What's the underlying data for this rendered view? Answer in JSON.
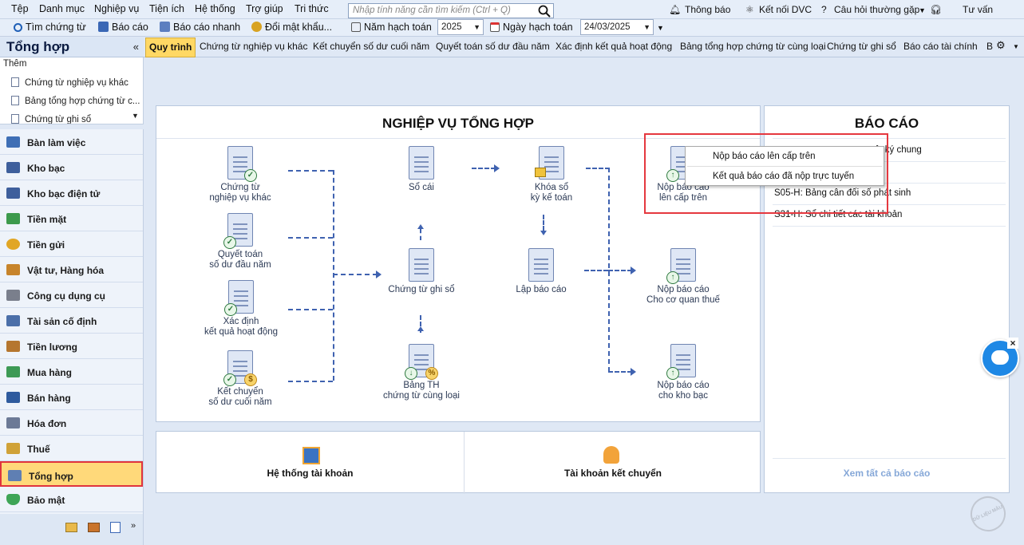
{
  "menu": {
    "items": [
      "Tệp",
      "Danh mục",
      "Nghiệp vụ",
      "Tiện ích",
      "Hệ thống",
      "Trợ giúp",
      "Tri thức"
    ],
    "search_placeholder": "Nhập tính năng cần tìm kiếm (Ctrl + Q)",
    "notify": "Thông báo",
    "connect": "Kết nối DVC",
    "faq": "Câu hỏi thường gặp",
    "support": "Tư vấn"
  },
  "toolbar": {
    "find": "Tìm chứng từ",
    "report": "Báo cáo",
    "quick_report": "Báo cáo nhanh",
    "change_pw": "Đổi mật khẩu...",
    "year_label": "Năm hạch toán",
    "year": "2025",
    "date_label": "Ngày hạch toán",
    "date": "24/03/2025"
  },
  "left": {
    "title": "Tổng hợp",
    "collapse": "«",
    "more": "Thêm",
    "sub_items": [
      "Chứng từ nghiệp vụ khác",
      "Bảng tổng hợp chứng từ c...",
      "Chứng từ ghi sổ"
    ],
    "nav": [
      "Bàn làm việc",
      "Kho bạc",
      "Kho bạc điện tử",
      "Tiền mặt",
      "Tiền gửi",
      "Vật tư, Hàng hóa",
      "Công cụ dụng cụ",
      "Tài sản cố định",
      "Tiền lương",
      "Mua hàng",
      "Bán hàng",
      "Hóa đơn",
      "Thuế",
      "Tổng hợp",
      "Bảo mật"
    ]
  },
  "tabs": [
    "Quy trình",
    "Chứng từ nghiệp vụ khác",
    "Kết chuyển số dư cuối năm",
    "Quyết toán số dư đầu năm",
    "Xác định kết quả hoạt động",
    "Bảng tổng hợp chứng từ cùng loại",
    "Chứng từ ghi sổ",
    "Báo cáo tài chính",
    "B"
  ],
  "flow": {
    "title": "NGHIỆP VỤ TỔNG HỢP",
    "n1a": "Chứng từ",
    "n1b": "nghiệp vụ khác",
    "n2a": "Quyết toán",
    "n2b": "số dư đầu năm",
    "n3a": "Xác định",
    "n3b": "kết quả hoạt động",
    "n4a": "Kết chuyển",
    "n4b": "số dư cuối năm",
    "so_cai": "Sổ cái",
    "ct_ghi_so": "Chứng từ ghi sổ",
    "bth_a": "Bảng TH",
    "bth_b": "chứng từ cùng loại",
    "khoa_a": "Khóa sổ",
    "khoa_b": "kỳ kế toán",
    "lap_bc": "Lập báo cáo",
    "np1a": "Nộp báo cáo",
    "np1b": "lên cấp trên",
    "np2a": "Nộp báo cáo",
    "np2b": "Cho cơ quan thuế",
    "np3a": "Nộp báo cáo",
    "np3b": "cho kho bạc"
  },
  "bottom": {
    "accounts": "Hệ thống tài khoản",
    "transfer": "Tài khoản kết chuyển"
  },
  "reports": {
    "title": "BÁO CÁO",
    "items": [
      "S02c-H: Sổ nhật ký chung",
      "",
      "S05-H: Bảng cân đối số phát sinh",
      "S31-H: Sổ chi tiết các tài khoản"
    ],
    "item1_visible": "ật ký chung",
    "see_all": "Xem tất cả báo cáo"
  },
  "context_menu": [
    "Nộp báo cáo lên cấp trên",
    "Kết quả báo cáo đã nộp trực tuyến"
  ],
  "watermark": "DỮ LIỆU MẪU"
}
